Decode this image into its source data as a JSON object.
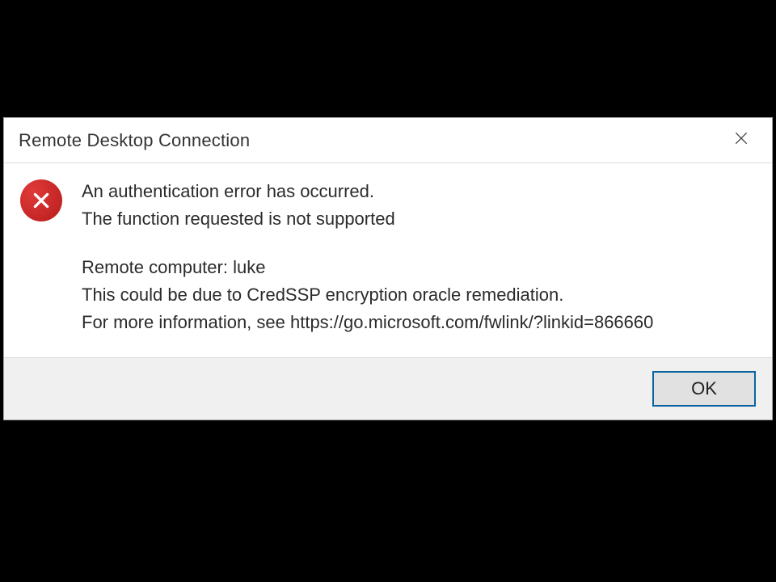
{
  "dialog": {
    "title": "Remote Desktop Connection",
    "message": {
      "line1": "An authentication error has occurred.",
      "line2": "The function requested is not supported",
      "line3": "Remote computer: luke",
      "line4": "This could be due to CredSSP encryption oracle remediation.",
      "line5": "For more information, see https://go.microsoft.com/fwlink/?linkid=866660"
    },
    "ok_label": "OK"
  }
}
